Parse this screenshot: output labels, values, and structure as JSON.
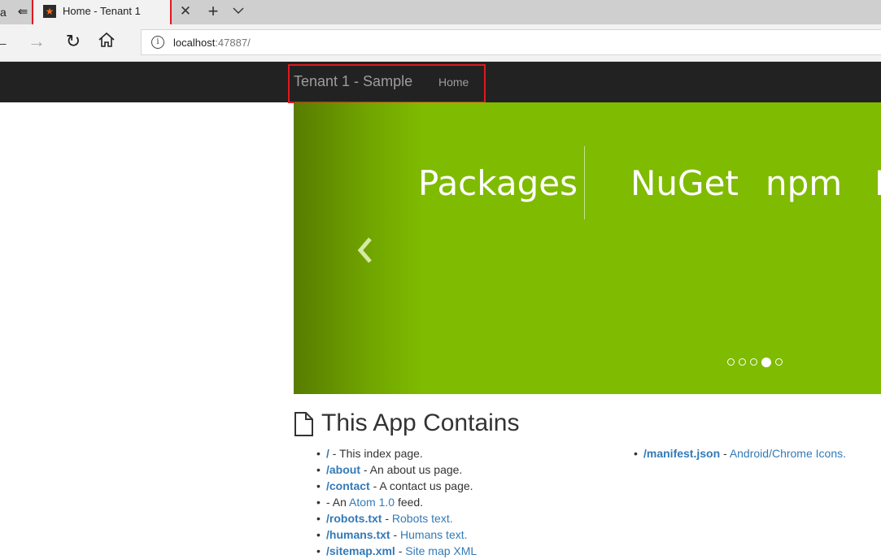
{
  "browser": {
    "left_partial_glyph": "a",
    "tab": {
      "title": "Home - Tenant 1"
    },
    "new_tab_glyph": "+",
    "address": {
      "host": "localhost",
      "port": ":47887/"
    }
  },
  "navbar": {
    "brand": "Tenant 1 - Sample",
    "home_label": "Home"
  },
  "carousel": {
    "title": "Packages",
    "items": [
      "NuGet",
      "npm",
      "B"
    ],
    "indicator_count": 5,
    "active_indicator": 4
  },
  "section": {
    "title": "This App Contains"
  },
  "contents": {
    "left": [
      {
        "path": "/",
        "dash": " - ",
        "text": "This index page."
      },
      {
        "path": "/about",
        "dash": " - ",
        "text": "An about us page."
      },
      {
        "path": "/contact",
        "dash": " - ",
        "text": "A contact us page."
      },
      {
        "prefix": " - An ",
        "link": "Atom 1.0",
        "suffix": " feed."
      },
      {
        "path": "/robots.txt",
        "dash": " - ",
        "link": "Robots text."
      },
      {
        "path": "/humans.txt",
        "dash": " - ",
        "link": "Humans text."
      },
      {
        "path": "/sitemap.xml",
        "dash": " - ",
        "link": "Site map XML"
      }
    ],
    "right": [
      {
        "path": "/manifest.json",
        "dash": " - ",
        "link": "Android/Chrome Icons."
      }
    ]
  },
  "colors": {
    "carousel_green": "#7fbb00",
    "navbar_bg": "#222222",
    "link_blue": "#337ab7",
    "highlight_red": "#e0191f"
  }
}
